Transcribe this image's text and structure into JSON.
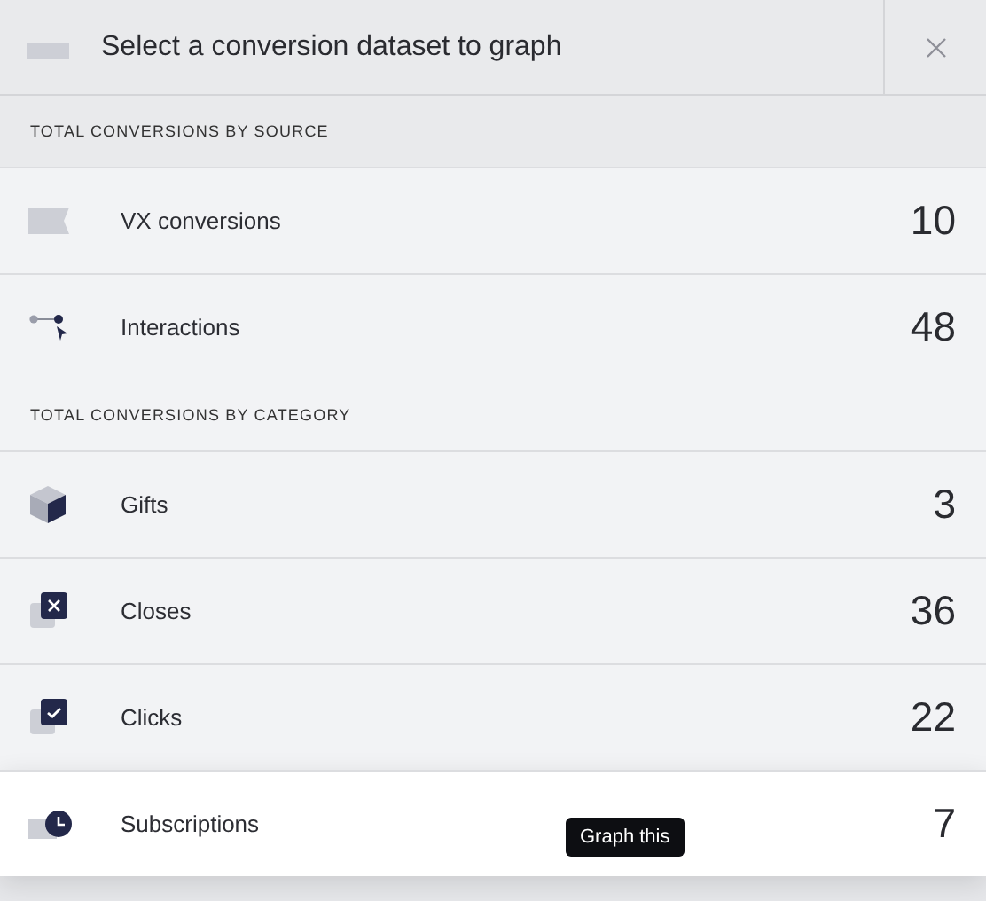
{
  "header": {
    "title": "Select a conversion dataset to graph"
  },
  "sections": [
    {
      "label": "TOTAL CONVERSIONS BY SOURCE",
      "items": [
        {
          "kind": "ticket",
          "label": "VX conversions",
          "count": "10",
          "highlighted": false
        },
        {
          "kind": "interactions",
          "label": "Interactions",
          "count": "48",
          "highlighted": false
        }
      ]
    },
    {
      "label": "TOTAL CONVERSIONS BY CATEGORY",
      "items": [
        {
          "kind": "cube",
          "label": "Gifts",
          "count": "3",
          "highlighted": false
        },
        {
          "kind": "xbox",
          "label": "Closes",
          "count": "36",
          "highlighted": false
        },
        {
          "kind": "checkbox",
          "label": "Clicks",
          "count": "22",
          "highlighted": false
        },
        {
          "kind": "clock",
          "label": "Subscriptions",
          "count": "7",
          "highlighted": true
        }
      ]
    }
  ],
  "tooltip": {
    "text": "Graph this"
  }
}
